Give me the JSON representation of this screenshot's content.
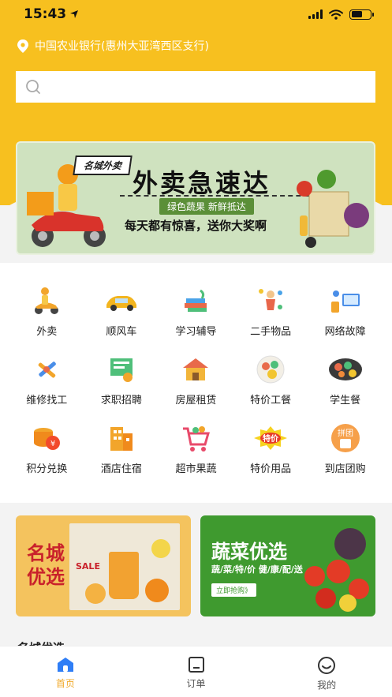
{
  "status_bar": {
    "time": "15:43"
  },
  "location": {
    "text": "中国农业银行(惠州大亚湾西区支行)"
  },
  "search": {
    "placeholder": ""
  },
  "banner": {
    "tag": "名城外卖",
    "title": "外卖急速达",
    "subtitle": "绿色蔬果 新鲜抵达",
    "promo": "每天都有惊喜，送你大奖啊"
  },
  "categories": [
    {
      "label": "外卖",
      "icon": "delivery-scooter-icon"
    },
    {
      "label": "顺风车",
      "icon": "car-icon"
    },
    {
      "label": "学习辅导",
      "icon": "books-icon"
    },
    {
      "label": "二手物品",
      "icon": "secondhand-items-icon"
    },
    {
      "label": "网络故障",
      "icon": "network-repair-icon"
    },
    {
      "label": "维修找工",
      "icon": "tools-icon"
    },
    {
      "label": "求职招聘",
      "icon": "job-board-icon"
    },
    {
      "label": "房屋租赁",
      "icon": "house-icon"
    },
    {
      "label": "特价工餐",
      "icon": "meal-plate-icon"
    },
    {
      "label": "学生餐",
      "icon": "student-meal-icon"
    },
    {
      "label": "积分兑换",
      "icon": "coins-icon"
    },
    {
      "label": "酒店住宿",
      "icon": "hotel-icon"
    },
    {
      "label": "超市果蔬",
      "icon": "shopping-cart-icon"
    },
    {
      "label": "特价用品",
      "icon": "special-price-icon"
    },
    {
      "label": "到店团购",
      "icon": "group-buy-bag-icon"
    }
  ],
  "promo_cards": {
    "left": {
      "title1": "名城",
      "title2": "优选",
      "sale": "SALE"
    },
    "right": {
      "title": "蔬菜优选",
      "subtitle": "蔬/菜/特/价 健/康/配/送",
      "cta": "立即抢购》"
    }
  },
  "section_title": "名城优选",
  "tabs": [
    {
      "label": "首页",
      "icon": "home-icon",
      "active": true
    },
    {
      "label": "订单",
      "icon": "order-icon",
      "active": false
    },
    {
      "label": "我的",
      "icon": "profile-smile-icon",
      "active": false
    }
  ],
  "colors": {
    "accent": "#f7c01f",
    "tab_active": "#f0a92a",
    "veg_green": "#3f9a2f"
  }
}
